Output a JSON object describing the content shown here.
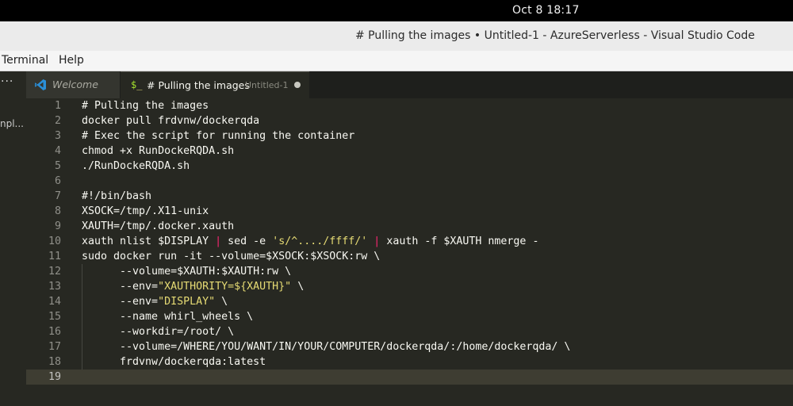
{
  "system": {
    "clock": "Oct 8  18:17"
  },
  "window": {
    "title": "# Pulling the images • Untitled-1 - AzureServerless - Visual Studio Code"
  },
  "menu": {
    "items": [
      "Terminal",
      "Help"
    ]
  },
  "activity_bar": {
    "more_label": "···",
    "side_label": "npl..."
  },
  "tabs": [
    {
      "label": "Welcome",
      "icon": "vscode-logo-icon"
    },
    {
      "label": "# Pulling the images",
      "description": "Untitled-1",
      "icon": "terminal-icon",
      "icon_text": "$_",
      "dirty": true
    }
  ],
  "editor": {
    "current_line": 19,
    "lines": [
      {
        "n": "1",
        "code": "# Pulling the images"
      },
      {
        "n": "2",
        "code": "docker pull frdvnw/dockerqda"
      },
      {
        "n": "3",
        "code": "# Exec the script for running the container"
      },
      {
        "n": "4",
        "code": "chmod +x RunDockeRQDA.sh"
      },
      {
        "n": "5",
        "code": "./RunDockeRQDA.sh"
      },
      {
        "n": "6",
        "code": ""
      },
      {
        "n": "7",
        "code": "#!/bin/bash"
      },
      {
        "n": "8",
        "code": "XSOCK=/tmp/.X11-unix"
      },
      {
        "n": "9",
        "code": "XAUTH=/tmp/.docker.xauth"
      },
      {
        "n": "10",
        "code": "xauth nlist $DISPLAY | sed -e 's/^..../ffff/' | xauth -f $XAUTH nmerge -"
      },
      {
        "n": "11",
        "code": "sudo docker run -it --volume=$XSOCK:$XSOCK:rw \\"
      },
      {
        "n": "12",
        "code": "      --volume=$XAUTH:$XAUTH:rw \\"
      },
      {
        "n": "13",
        "code": "      --env=\"XAUTHORITY=${XAUTH}\" \\"
      },
      {
        "n": "14",
        "code": "      --env=\"DISPLAY\" \\"
      },
      {
        "n": "15",
        "code": "      --name whirl_wheels \\"
      },
      {
        "n": "16",
        "code": "      --workdir=/root/ \\"
      },
      {
        "n": "17",
        "code": "      --volume=/WHERE/YOU/WANT/IN/YOUR/COMPUTER/dockerqda/:/home/dockerqda/ \\"
      },
      {
        "n": "18",
        "code": "      frdvnw/dockerqda:latest"
      },
      {
        "n": "19",
        "code": ""
      }
    ]
  },
  "colors": {
    "editor_bg": "#272822",
    "comment": "#75715e",
    "string": "#e6db74",
    "operator": "#f92672",
    "text": "#f8f8f2",
    "accent_vscode": "#2a8fd8"
  }
}
